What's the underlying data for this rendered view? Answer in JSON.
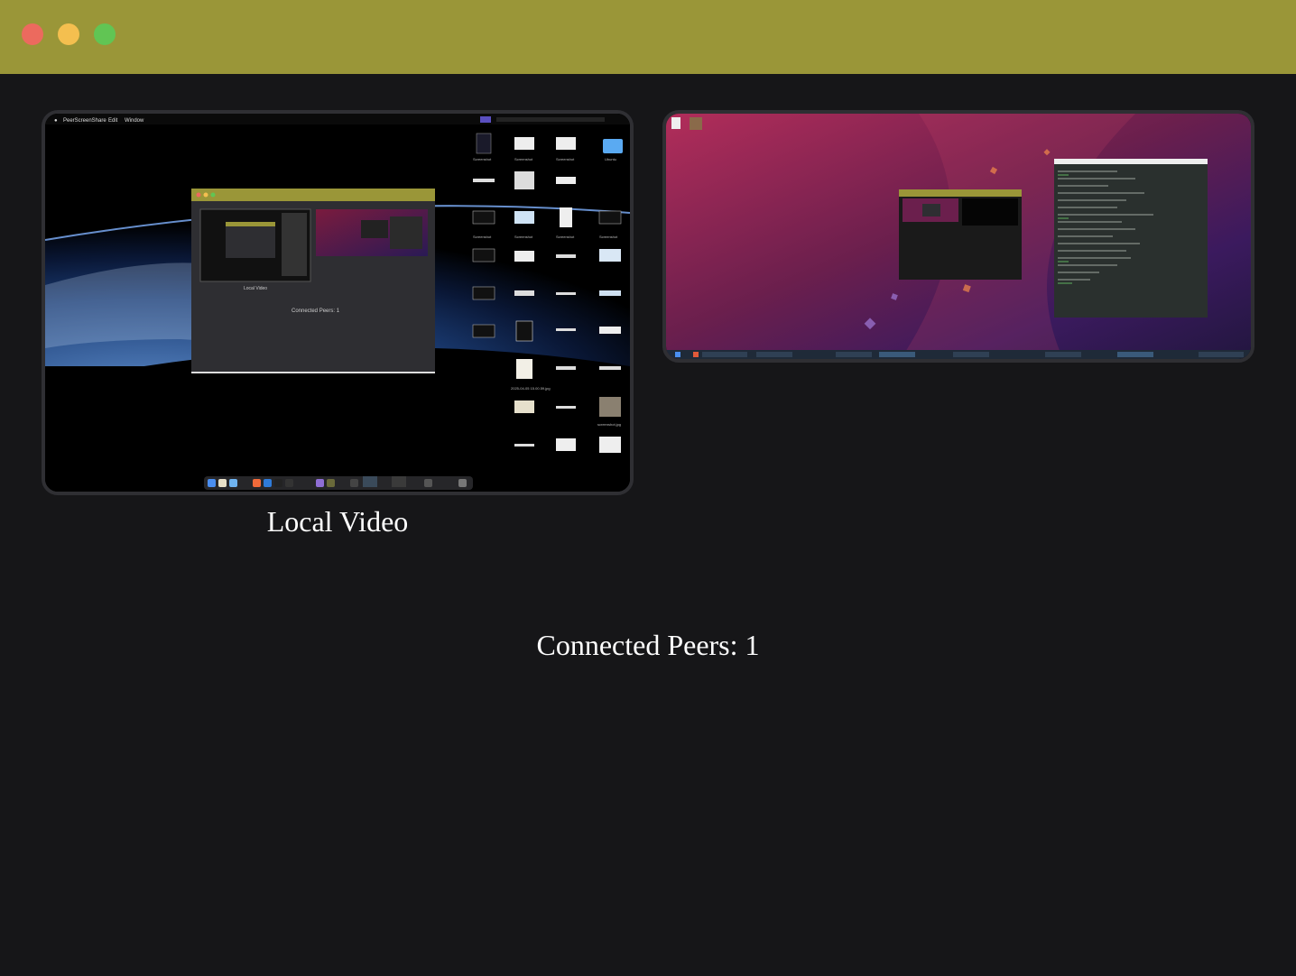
{
  "window": {
    "titlebar_color": "#9a9638",
    "background_color": "#161618",
    "controls": [
      "close",
      "minimize",
      "maximize"
    ]
  },
  "local_video": {
    "caption": "Local Video",
    "menubar": {
      "app_name": "PeerScreenShare",
      "items": [
        "Edit",
        "Window"
      ]
    },
    "nested_caption": "Local Video",
    "nested_peers": "Connected Peers: 1",
    "desktop_icons": [
      "Screenshot 2025-0...3PM.png",
      "Screenshot 2025-0...0AM.png",
      "Screenshot 2025-0...0AM.png",
      "Screenshot 2025-0...5PM.png",
      "2025-04-05 15.00.59.jpg",
      "screenshot.jpg"
    ]
  },
  "remote_video": {
    "label": "remote-peer-video"
  },
  "status": {
    "connected_peers_text": "Connected Peers: 1"
  }
}
